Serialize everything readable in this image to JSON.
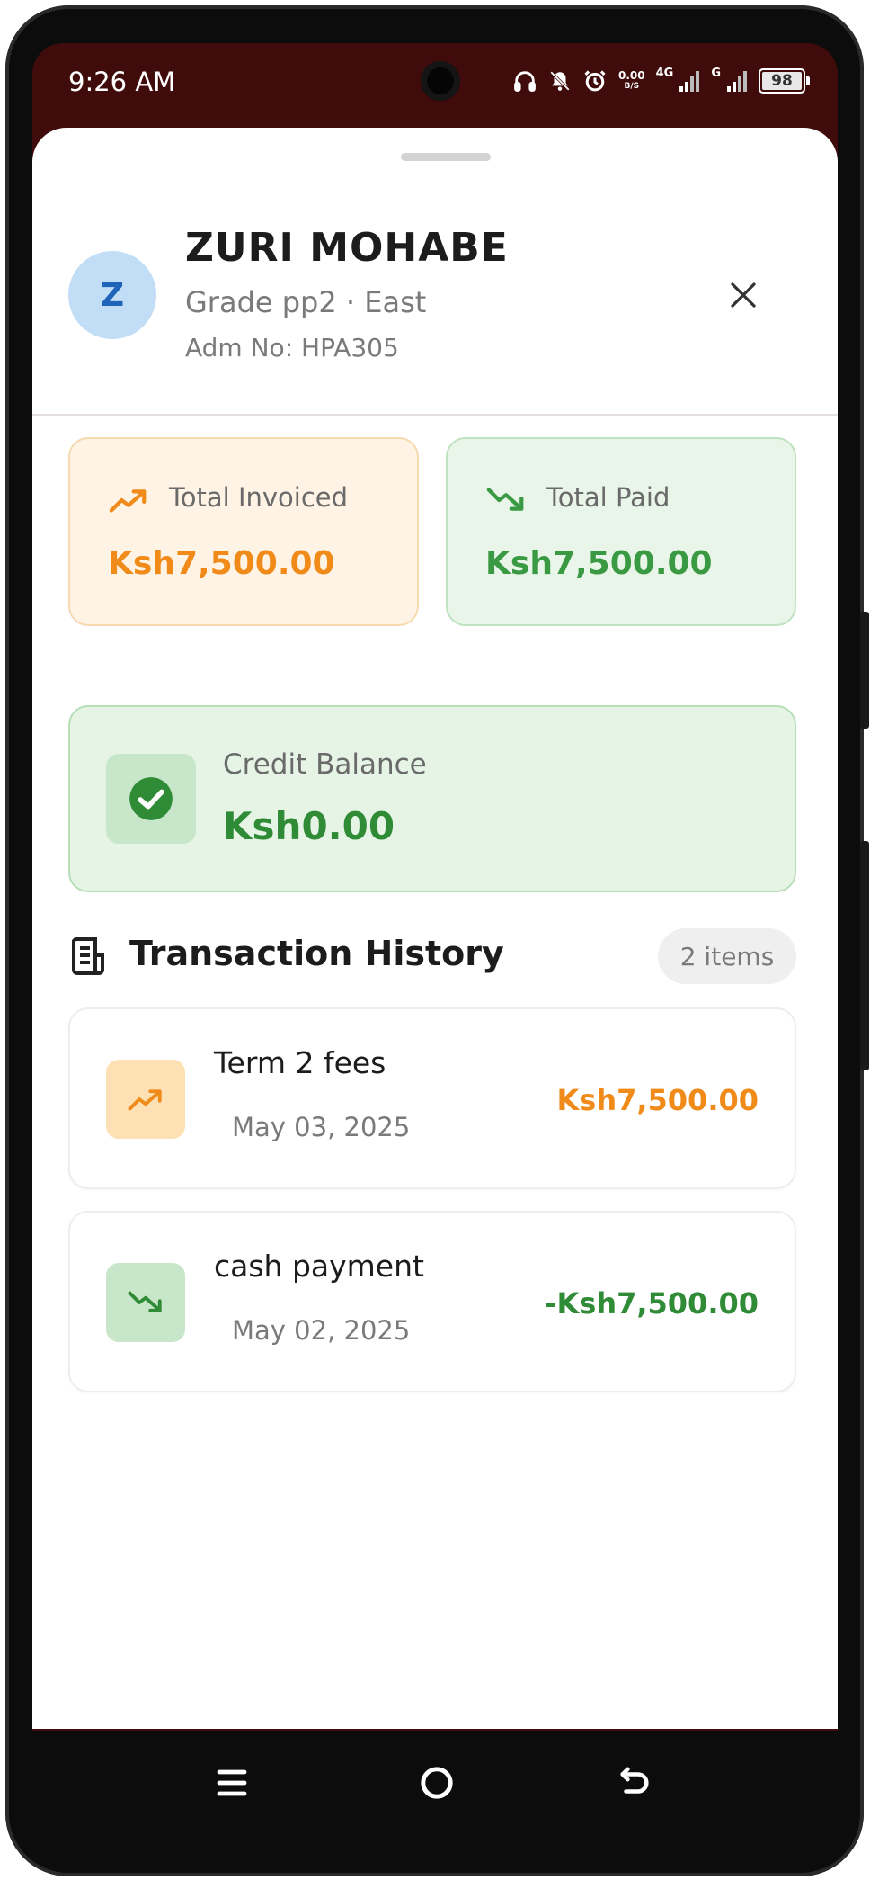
{
  "status_bar": {
    "time": "9:26 AM",
    "speed_value": "0.00",
    "speed_unit": "B/S",
    "net1": "4G",
    "net2": "G",
    "battery": "98"
  },
  "student": {
    "initial": "Z",
    "name": "ZURI MOHABE",
    "grade_line": "Grade pp2 · East",
    "adm_line": "Adm No: HPA305"
  },
  "summary": {
    "invoiced_label": "Total Invoiced",
    "invoiced_amount": "Ksh7,500.00",
    "paid_label": "Total Paid",
    "paid_amount": "Ksh7,500.00",
    "credit_label": "Credit Balance",
    "credit_amount": "Ksh0.00"
  },
  "history": {
    "title": "Transaction History",
    "count_badge": "2 items",
    "items": [
      {
        "description": "Term 2 fees",
        "date": "May 03, 2025",
        "amount": "Ksh7,500.00",
        "icon": "trending-up-icon"
      },
      {
        "description": "cash payment",
        "date": "May 02, 2025",
        "amount": "-Ksh7,500.00",
        "icon": "trending-down-icon"
      }
    ]
  },
  "colors": {
    "accent_orange": "#f08a18",
    "accent_green": "#2f8b36",
    "status_bar_bg": "#3f0b0b",
    "avatar_bg": "#c2ddf6"
  }
}
